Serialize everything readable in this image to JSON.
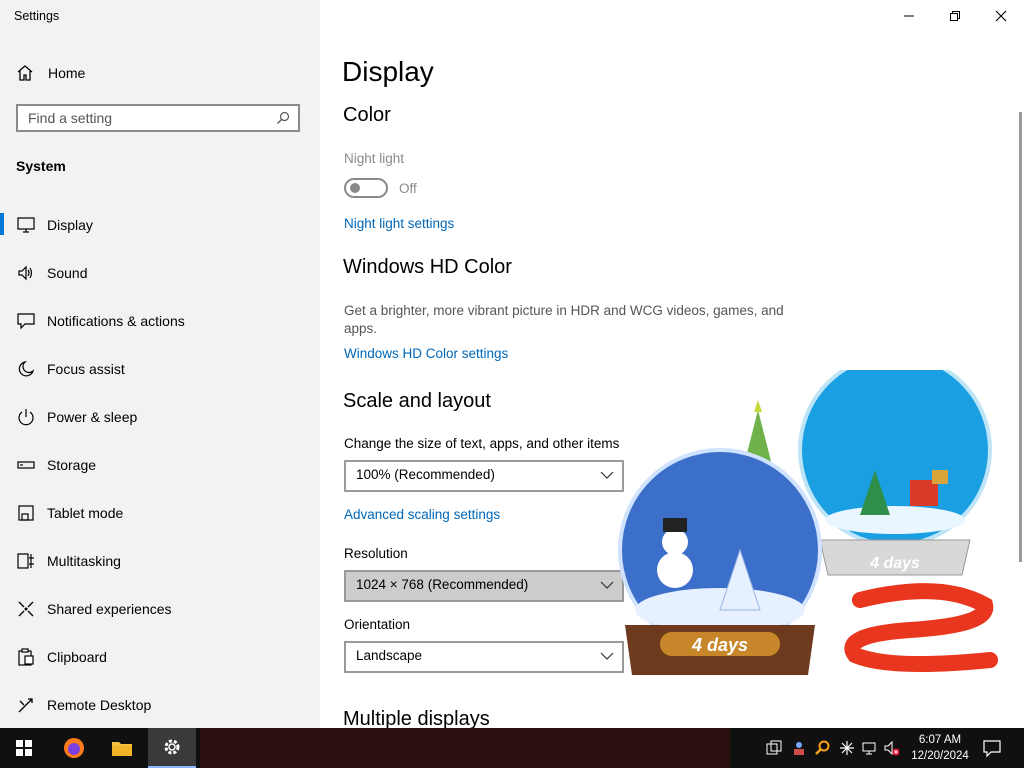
{
  "window": {
    "title": "Settings",
    "minimize_icon": "minimize-icon",
    "maximize_icon": "restore-icon",
    "close_icon": "close-icon"
  },
  "sidebar": {
    "home_label": "Home",
    "search_placeholder": "Find a setting",
    "section": "System",
    "items": [
      {
        "label": "Display",
        "icon": "monitor-icon",
        "active": true
      },
      {
        "label": "Sound",
        "icon": "speaker-icon"
      },
      {
        "label": "Notifications & actions",
        "icon": "notification-icon"
      },
      {
        "label": "Focus assist",
        "icon": "moon-icon"
      },
      {
        "label": "Power & sleep",
        "icon": "power-icon"
      },
      {
        "label": "Storage",
        "icon": "storage-icon"
      },
      {
        "label": "Tablet mode",
        "icon": "tablet-icon"
      },
      {
        "label": "Multitasking",
        "icon": "multitasking-icon"
      },
      {
        "label": "Shared experiences",
        "icon": "shared-icon"
      },
      {
        "label": "Clipboard",
        "icon": "clipboard-icon"
      },
      {
        "label": "Remote Desktop",
        "icon": "remote-desktop-icon"
      }
    ]
  },
  "main": {
    "title": "Display",
    "color": {
      "heading": "Color",
      "night_light_label": "Night light",
      "night_light_state": "Off",
      "night_light_link": "Night light settings"
    },
    "hd_color": {
      "heading": "Windows HD Color",
      "description": "Get a brighter, more vibrant picture in HDR and WCG videos, games, and apps.",
      "link": "Windows HD Color settings"
    },
    "scale": {
      "heading": "Scale and layout",
      "scale_label": "Change the size of text, apps, and other items",
      "scale_value": "100% (Recommended)",
      "advanced_link": "Advanced scaling settings",
      "resolution_label": "Resolution",
      "resolution_value": "1024 × 768 (Recommended)",
      "orientation_label": "Orientation",
      "orientation_value": "Landscape"
    },
    "multiple_displays_heading": "Multiple displays"
  },
  "decoration": {
    "globe1_text": "4 days",
    "globe2_text": "4 days"
  },
  "taskbar": {
    "time": "6:07 AM",
    "date": "12/20/2024",
    "accent": "#0078d7"
  }
}
